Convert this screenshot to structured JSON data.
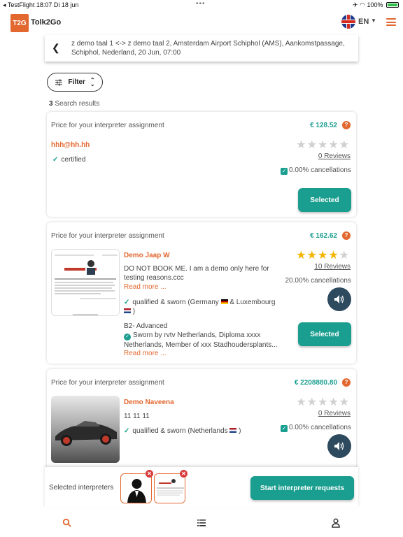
{
  "status_bar": {
    "left": "◂ TestFlight  18:07  Di 18 jun",
    "right": "100%"
  },
  "app": {
    "logo_badge": "T2G",
    "name": "Tolk2Go",
    "language": "EN",
    "accent_color": "#e2682f",
    "primary_color": "#1a9e8f"
  },
  "search_summary": {
    "text": "z demo taal 1 <-> z demo taal 2, Amsterdam Airport Schiphol (AMS), Aankomstpassage, Schiphol, Nederland, 20 Jun, 07:00"
  },
  "filter": {
    "label": "Filter"
  },
  "results": {
    "count": "3",
    "label": "Search results"
  },
  "cards": [
    {
      "price_label": "Price for your interpreter assignment",
      "price": "€ 128.52",
      "help": "?",
      "name": "hhh@hh.hh",
      "rating": 0,
      "reviews": "0 Reviews",
      "cancellations": "0.00% cancellations",
      "status": "certified",
      "button": "Selected"
    },
    {
      "price_label": "Price for your interpreter assignment",
      "price": "€ 162.62",
      "help": "?",
      "name": "Demo Jaap W",
      "rating": 4,
      "reviews": "10 Reviews",
      "cancellations": "20.00% cancellations",
      "description": "DO NOT BOOK ME. I am a demo only here for testing reasons.ccc",
      "read_more_1": "Read more ...",
      "qualification_a": "qualified & sworn (Germany",
      "qualification_b": "& Luxembourg",
      "qualification_c": ")",
      "level": "B2- Advanced",
      "sworn_1": "Sworn by rvtv Netherlands, Diploma xxxx",
      "sworn_2": "Netherlands, Member of xxx Stadhoudersplants...",
      "read_more_2": "Read more ...",
      "button": "Selected"
    },
    {
      "price_label": "Price for your interpreter assignment",
      "price": "€ 2208880.80",
      "help": "?",
      "name": "Demo Naveena",
      "rating": 0,
      "reviews": "0 Reviews",
      "cancellations": "0.00% cancellations",
      "description": "11 11 11",
      "qualification_a": "qualified & sworn (Netherlands",
      "qualification_c": ")"
    }
  ],
  "selected_bar": {
    "label": "Selected interpreters",
    "start_button": "Start interpreter requests"
  },
  "tabbar": {
    "items": [
      "search-icon",
      "list-icon",
      "profile-icon"
    ]
  }
}
